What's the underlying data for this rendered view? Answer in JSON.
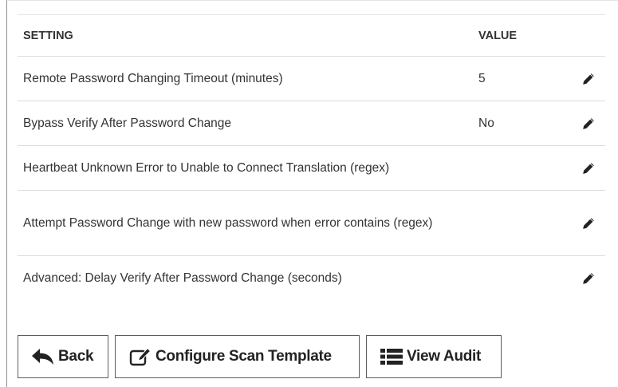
{
  "table": {
    "headers": {
      "setting": "SETTING",
      "value": "VALUE"
    },
    "rows": [
      {
        "setting": "Remote Password Changing Timeout (minutes)",
        "value": "5"
      },
      {
        "setting": "Bypass Verify After Password Change",
        "value": "No"
      },
      {
        "setting": "Heartbeat Unknown Error to Unable to Connect Translation (regex)",
        "value": ""
      },
      {
        "setting": "Attempt Password Change with new password when error contains (regex)",
        "value": ""
      },
      {
        "setting": "Advanced: Delay Verify After Password Change (seconds)",
        "value": ""
      }
    ],
    "edit_icon": "pencil-icon"
  },
  "actions": {
    "back_label": "Back",
    "back_icon": "reply-arrow-icon",
    "configure_label": "Configure Scan Template",
    "configure_icon": "edit-square-icon",
    "audit_label": "View Audit",
    "audit_icon": "list-icon"
  }
}
